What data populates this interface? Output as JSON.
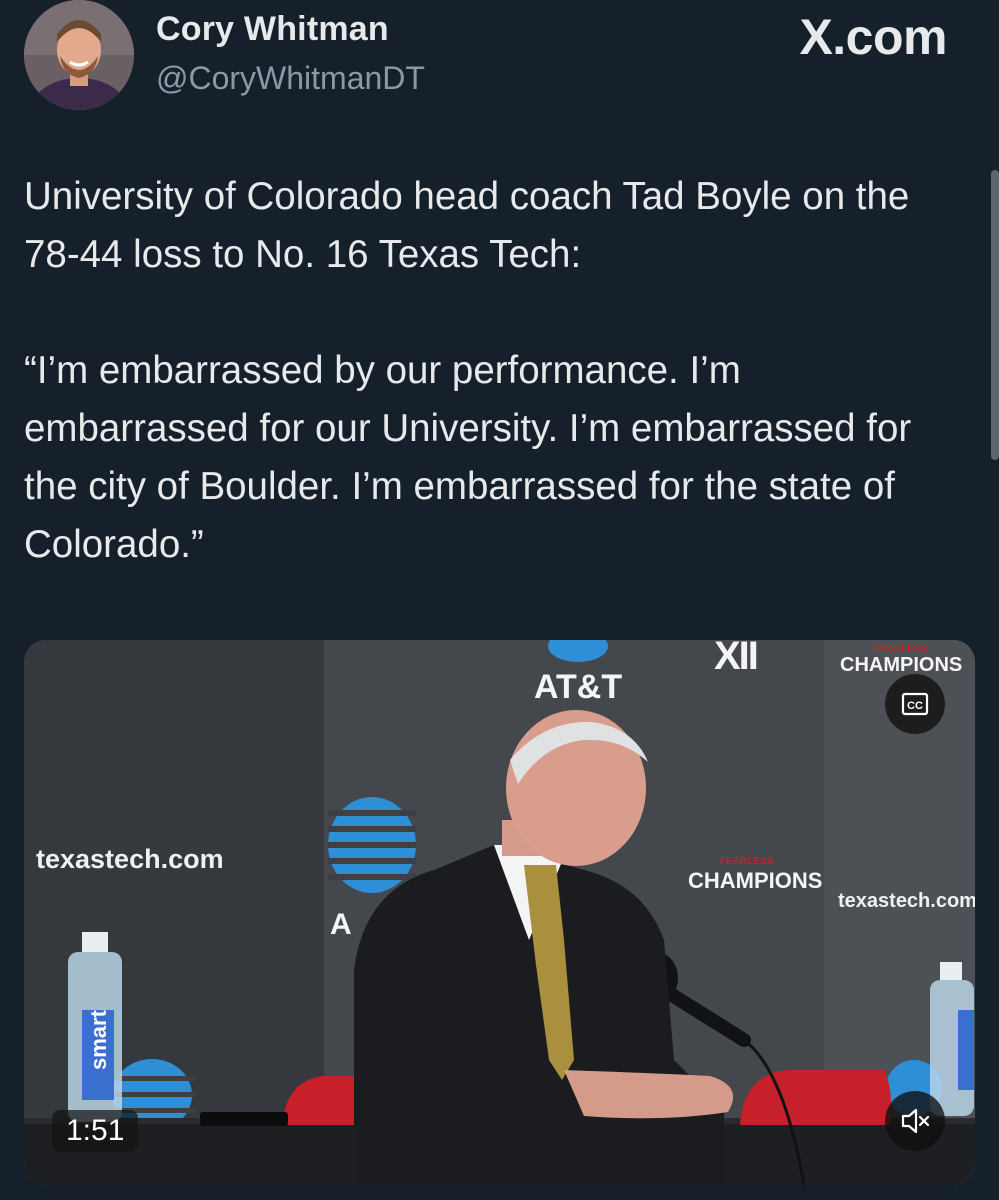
{
  "author": {
    "name": "Cory Whitman",
    "handle": "@CoryWhitmanDT"
  },
  "site": {
    "logo_text": "X.com"
  },
  "tweet": {
    "paragraphs": [
      "University of Colorado head coach Tad Boyle on the 78-44 loss to No. 16 Texas Tech:",
      "“I’m embarrassed by our performance. I’m embarrassed for our University. I’m embarrassed for the city of Boulder. I’m embarrassed for the state of Colorado.”"
    ]
  },
  "video": {
    "duration": "1:51",
    "cc_icon": "closed-captions-icon",
    "mute_icon": "speaker-muted-icon",
    "backdrop": {
      "att_text": "AT&T",
      "att_partial": "A",
      "big12_text": "XII",
      "fearless_text": "FEARLESS",
      "champions_text": "CHAMPIONS",
      "texastech_text": "texastech.com",
      "bottle_brand": "smart"
    }
  },
  "colors": {
    "background": "#15202b",
    "text_primary": "#e7e9ea",
    "text_secondary": "#8b98a5",
    "att_blue": "#2f8fd6",
    "tech_red": "#cc1f2b"
  }
}
